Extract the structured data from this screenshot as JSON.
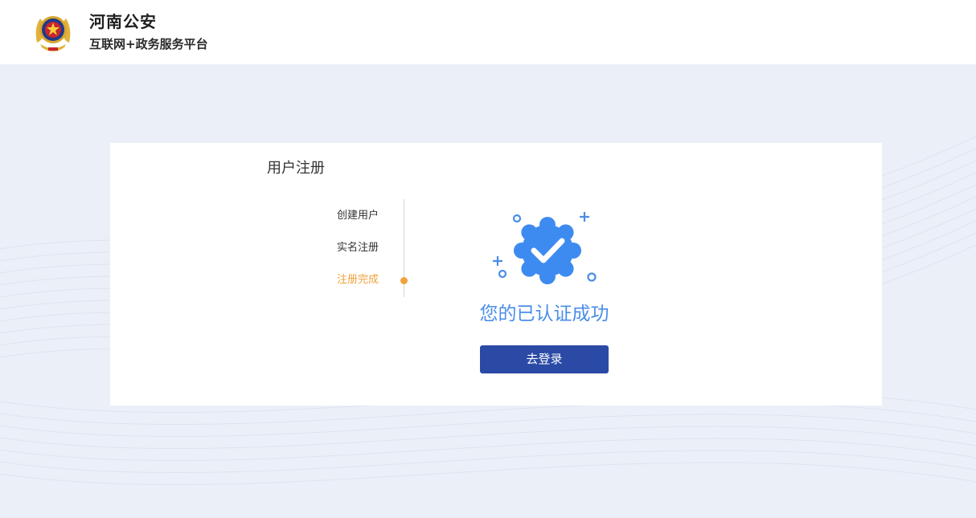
{
  "header": {
    "title": "河南公安",
    "subtitle": "互联网+政务服务平台",
    "emblem_icon": "police-emblem-icon"
  },
  "card": {
    "title": "用户注册",
    "steps": [
      {
        "label": "创建用户",
        "state": "done"
      },
      {
        "label": "实名注册",
        "state": "done"
      },
      {
        "label": "注册完成",
        "state": "current"
      }
    ],
    "success_icon": "verified-badge-icon",
    "success_message": "您的已认证成功",
    "login_button": "去登录"
  },
  "colors": {
    "accent_blue": "#4a8de8",
    "button_blue": "#2a4aa6",
    "current_step": "#f0a23b",
    "background": "#ebeff7"
  }
}
